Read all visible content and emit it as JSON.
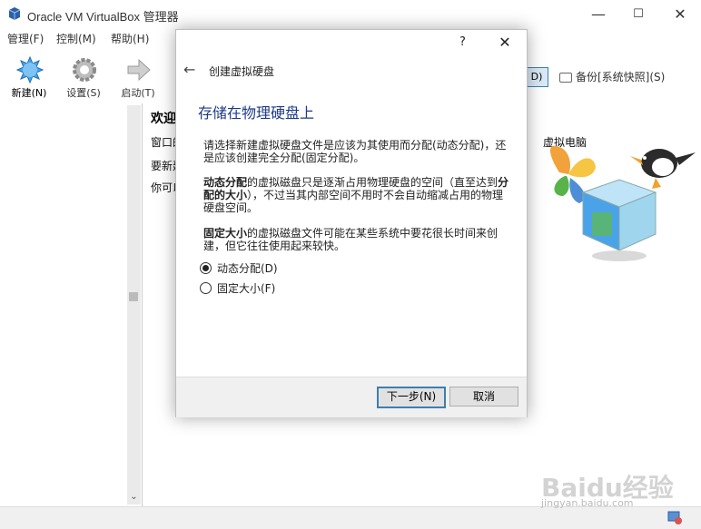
{
  "window": {
    "title": "Oracle VM VirtualBox 管理器",
    "minimize": "—",
    "maximize": "☐",
    "close": "✕"
  },
  "menu": [
    "管理(F)",
    "控制(M)",
    "帮助(H)"
  ],
  "toolbar": {
    "new_label": "新建(N)",
    "settings_label": "设置(S)",
    "start_label": "启动(T)",
    "details_label": "D)",
    "snapshot_label": "备份[系统快照](S)"
  },
  "welcome": {
    "title": "欢迎",
    "line1": "窗口的",
    "line2": "要新建",
    "line3": "你可以",
    "tail1": "虚拟电脑",
    "tail2": "."
  },
  "dialog": {
    "help": "?",
    "close": "✕",
    "back": "←",
    "heading": "创建虚拟硬盘",
    "section_title": "存储在物理硬盘上",
    "para1": "请选择新建虚拟硬盘文件是应该为其使用而分配(动态分配)，还是应该创建完全分配(固定分配)。",
    "para2_bold1": "动态分配",
    "para2_a": "的虚拟磁盘只是逐渐占用物理硬盘的空间（直至达到",
    "para2_bold2": "分配的大小",
    "para2_b": "），不过当其内部空间不用时不会自动缩减占用的物理硬盘空间。",
    "para3_bold": "固定大小",
    "para3_rest": "的虚拟磁盘文件可能在某些系统中要花很长时间来创建，但它往往使用起来较快。",
    "option_dynamic": "动态分配(D)",
    "option_fixed": "固定大小(F)",
    "selected": "dynamic",
    "next_label": "下一步(N)",
    "cancel_label": "取消"
  },
  "watermark": {
    "brand": "Baidu经验",
    "url": "jingyan.baidu.com"
  },
  "colors": {
    "accent": "#3c7fb1",
    "section_title": "#1f3b88"
  }
}
